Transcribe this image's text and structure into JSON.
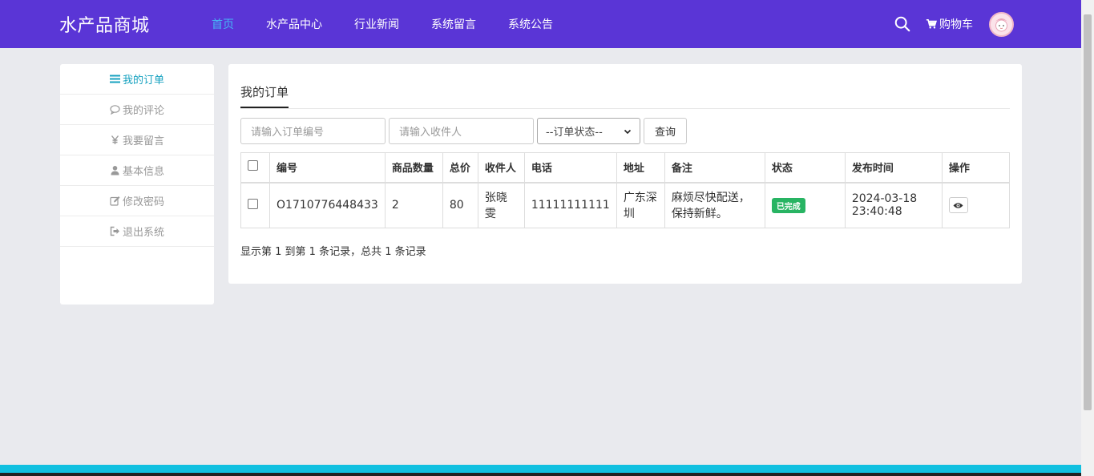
{
  "brand": "水产品商城",
  "nav": {
    "items": [
      {
        "label": "首页",
        "active": true
      },
      {
        "label": "水产品中心"
      },
      {
        "label": "行业新闻"
      },
      {
        "label": "系统留言"
      },
      {
        "label": "系统公告"
      }
    ],
    "cart_label": "购物车"
  },
  "sidebar": {
    "items": [
      {
        "label": "我的订单",
        "icon": "list-icon",
        "active": true
      },
      {
        "label": "我的评论",
        "icon": "comment-icon"
      },
      {
        "label": "我要留言",
        "icon": "yen-icon"
      },
      {
        "label": "基本信息",
        "icon": "user-icon"
      },
      {
        "label": "修改密码",
        "icon": "edit-icon"
      },
      {
        "label": "退出系统",
        "icon": "sign-out-icon"
      }
    ]
  },
  "main": {
    "tab": "我的订单",
    "filters": {
      "order_no_placeholder": "请输入订单编号",
      "receiver_placeholder": "请输入收件人",
      "status_select": "--订单状态--",
      "query_button": "查询"
    },
    "table": {
      "headers": [
        "编号",
        "商品数量",
        "总价",
        "收件人",
        "电话",
        "地址",
        "备注",
        "状态",
        "发布时间",
        "操作"
      ],
      "rows": [
        {
          "order_no": "O1710776448433",
          "quantity": "2",
          "total": "80",
          "receiver": "张晓雯",
          "phone": "11111111111",
          "address": "广东深圳",
          "remark": "麻烦尽快配送，保持新鲜。",
          "status": "已完成",
          "time": "2024-03-18 23:40:48"
        }
      ]
    },
    "pagination_info": "显示第 1 到第 1 条记录，总共 1 条记录"
  },
  "colors": {
    "navbar": "#5a35d6",
    "nav_active": "#45b6f5",
    "sidebar_active": "#17a2c0",
    "status_badge": "#28b463",
    "footer_bar": "#10c0e0"
  }
}
